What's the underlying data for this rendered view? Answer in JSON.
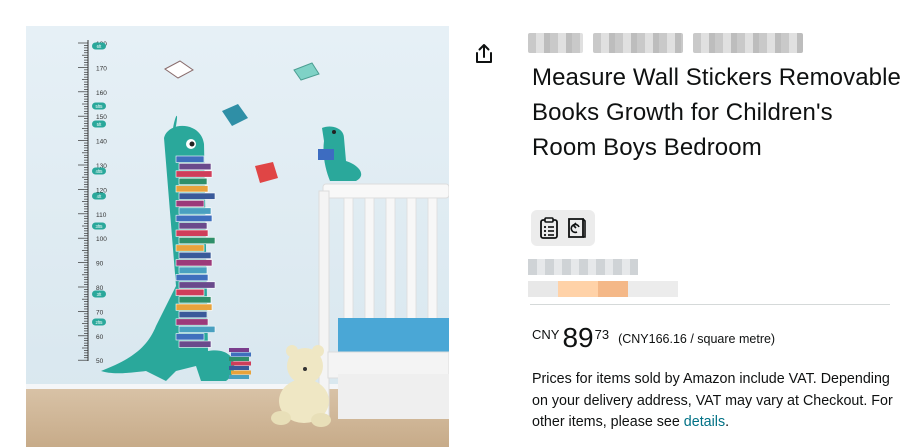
{
  "product": {
    "title": "Measure Wall Stickers Removable Books Growth for Children's Room Boys Bedroom",
    "image_alt": "Dinosaur height chart wall sticker with stacked books next to a white crib"
  },
  "chart_ruler": {
    "ticks": [
      "180",
      "170",
      "160",
      "150",
      "140",
      "130",
      "120",
      "110",
      "100",
      "90",
      "80",
      "70",
      "60",
      "50"
    ],
    "ft_labels": [
      "6ft",
      "5ft5",
      "5ft",
      "4ft5",
      "4ft",
      "3ft5",
      "3ft",
      "2ft5"
    ]
  },
  "icons": {
    "share": "share-icon",
    "chip": [
      "clipboard-icon",
      "book-refresh-icon"
    ]
  },
  "price": {
    "currency": "CNY",
    "whole": "89",
    "fraction": "73",
    "unit_price": "(CNY166.16 / square metre)"
  },
  "vat": {
    "text": "Prices for items sold by Amazon include VAT. Depending on your delivery address, VAT may vary at Checkout. For other items, please see ",
    "link": "details",
    "end": "."
  },
  "colors": {
    "link": "#007185",
    "wall": "#e2edf4",
    "dino": "#2aa89b"
  }
}
